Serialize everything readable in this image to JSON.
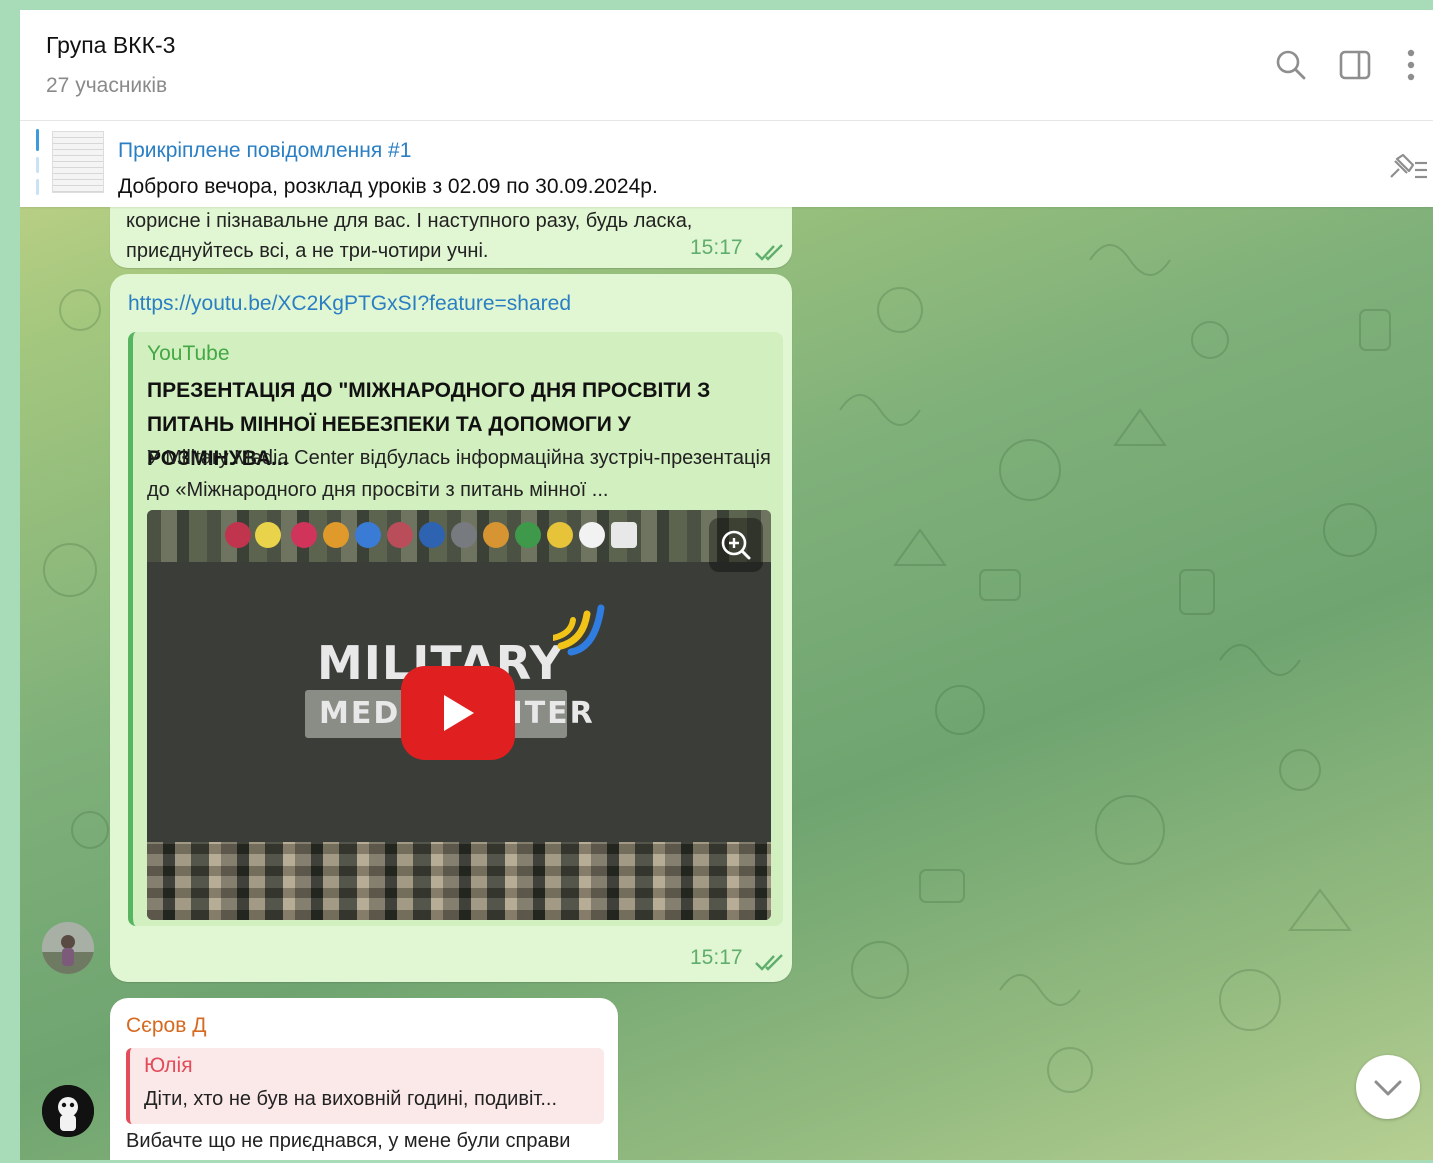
{
  "header": {
    "title": "Група ВКК-3",
    "subtitle": "27 учасників",
    "icons": [
      "search-icon",
      "sidebar-toggle-icon",
      "more-vertical-icon"
    ]
  },
  "pinned": {
    "title": "Прикріплене повідомлення #1",
    "text": "Доброго вечора, розклад уроків з 02.09 по 30.09.2024р.",
    "icons": [
      "unpin-list-icon"
    ]
  },
  "messages": [
    {
      "line1": "корисне і пізнавальне для вас. І наступного разу, будь ласка,",
      "line2": "приєднуйтесь всі, а не три-чотири учні.",
      "time": "15:17"
    },
    {
      "link": "https://youtu.be/XC2KgPTGxSI?feature=shared",
      "preview": {
        "site": "YouTube",
        "title": "ПРЕЗЕНТАЦІЯ ДО \"МІЖНАРОДНОГО ДНЯ ПРОСВІТИ З ПИТАНЬ МІННОЇ НЕБЕЗПЕКИ ТА ДОПОМОГИ У РОЗМІНУВА...",
        "description": "У Military Media Center відбулась інформаційна зустріч-презентація до «Міжнародного дня просвіти з питань мінної ...",
        "image_brand_line1": "MILITARY",
        "image_brand_line2": "MEDIA CENTER"
      },
      "time": "15:17"
    },
    {
      "sender": "Сєров Д",
      "reply_name": "Юлія",
      "reply_text": "Діти, хто не був на виховній годині, подивіт...",
      "text": "Вибачте що не приєднався, у мене були справи"
    }
  ],
  "colors": {
    "outgoing_bubble": "#e1f6d2",
    "link": "#2a7fc4",
    "youtube_site": "#43a845",
    "sender_name": "#d66a20",
    "reply_accent": "#e34c5a",
    "play_button": "#e02020"
  }
}
